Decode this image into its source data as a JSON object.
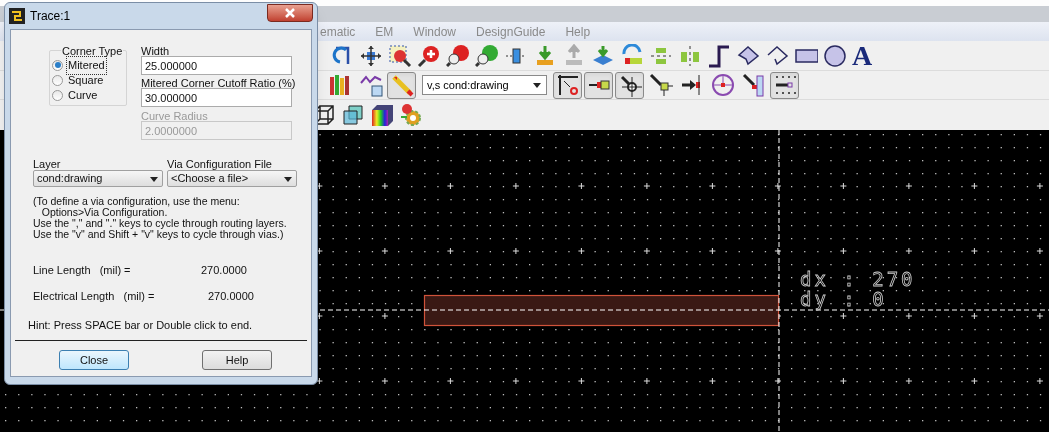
{
  "dialog": {
    "title": "Trace:1",
    "corner_type": {
      "label": "Corner Type",
      "options": [
        {
          "label": "Mitered",
          "selected": true
        },
        {
          "label": "Square",
          "selected": false
        },
        {
          "label": "Curve",
          "selected": false
        }
      ]
    },
    "width": {
      "label": "Width",
      "value": "25.000000",
      "disabled": false
    },
    "cutoff": {
      "label": "Mitered Corner Cutoff Ratio (%)",
      "value": "30.000000",
      "disabled": false
    },
    "curve_radius": {
      "label": "Curve Radius",
      "value": "2.0000000",
      "disabled": true
    },
    "layer": {
      "label": "Layer",
      "value": "cond:drawing"
    },
    "via_config": {
      "label": "Via Configuration File",
      "value": "<Choose a file>"
    },
    "info_lines": [
      "(To define a via configuration, use the menu:",
      "   Options>Via Configuration.",
      "Use the \",\" and \".\" keys to cycle through routing layers.",
      "Use the \"v\" and Shift + \"v\" keys to cycle through vias.)"
    ],
    "line_length": {
      "label": "Line Length   (mil) =",
      "value": "270.0000"
    },
    "electrical_length": {
      "label": "Electrical Length   (mil) =",
      "value": "270.0000"
    },
    "hint": "Hint: Press SPACE bar or Double click to end.",
    "buttons": [
      {
        "label": "Close",
        "default": true
      },
      {
        "label": "Help",
        "default": false
      }
    ]
  },
  "menu": [
    "ematic",
    "EM",
    "Window",
    "DesignGuide",
    "Help"
  ],
  "toolbar_1": {
    "text_tool": "A"
  },
  "toolbar_2": [
    {
      "kind": "books",
      "pressed": false
    },
    {
      "kind": "chart",
      "pressed": false
    },
    {
      "kind": "pencil",
      "pressed": true
    },
    {
      "kind": "dropdown",
      "value": "v,s cond:drawing"
    },
    {
      "kind": "snap-corner",
      "pressed": true
    },
    {
      "kind": "snap-pin",
      "pressed": true
    },
    {
      "kind": "snap-vertex",
      "pressed": true
    },
    {
      "kind": "snap-arrow",
      "pressed": false
    },
    {
      "kind": "snap-edge",
      "pressed": false
    },
    {
      "kind": "snap-center",
      "pressed": false
    },
    {
      "kind": "snap-side",
      "pressed": false
    },
    {
      "kind": "snap-grid",
      "pressed": true
    }
  ],
  "canvas": {
    "readout": [
      "dx : 270",
      "dy : 0"
    ]
  }
}
